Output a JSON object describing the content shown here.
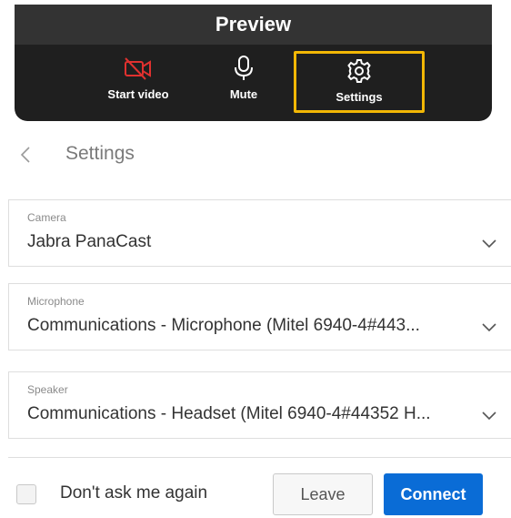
{
  "preview": {
    "title": "Preview",
    "controls": {
      "start_video_label": "Start video",
      "mute_label": "Mute",
      "settings_label": "Settings"
    },
    "video_off_color": "#e0312f",
    "highlight_color": "#f2b705"
  },
  "settings": {
    "title": "Settings",
    "camera": {
      "label": "Camera",
      "value": "Jabra PanaCast"
    },
    "microphone": {
      "label": "Microphone",
      "value": "Communications - Microphone (Mitel 6940-4#443..."
    },
    "speaker": {
      "label": "Speaker",
      "value": "Communications - Headset (Mitel 6940-4#44352 H..."
    }
  },
  "footer": {
    "dont_ask_label": "Don't ask me again",
    "dont_ask_checked": false,
    "leave_label": "Leave",
    "connect_label": "Connect",
    "connect_color": "#0a6cd6"
  },
  "icons": {
    "video": "video-off-icon",
    "mute": "microphone-icon",
    "settings": "gear-icon",
    "back": "chevron-left-icon",
    "dropdown": "chevron-down-icon"
  }
}
